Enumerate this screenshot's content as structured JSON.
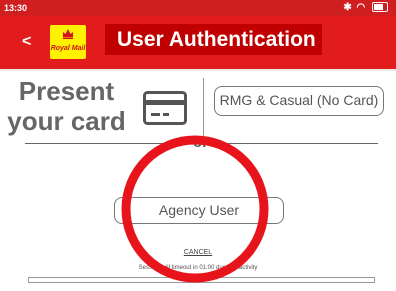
{
  "status": {
    "time": "13:30",
    "icons": [
      "bluetooth-icon",
      "wifi-icon",
      "battery-icon"
    ]
  },
  "header": {
    "back_label": "<",
    "logo_text": "Royal Mail",
    "title": "User Authentication"
  },
  "card": {
    "present_label": "Present\nyour card",
    "icon": "card-icon"
  },
  "rmg_button_label": "RMG & Casual (No Card)",
  "divider_label": "or",
  "agency_button_label": "Agency User",
  "cancel_label": "CANCEL",
  "session_text": "Session will timeout in 01:00 due to inactivity",
  "colors": {
    "brand_red": "#e21c1c",
    "title_red": "#c00000",
    "logo_yellow": "#fff200",
    "annotation_ring": "#e8141c"
  }
}
